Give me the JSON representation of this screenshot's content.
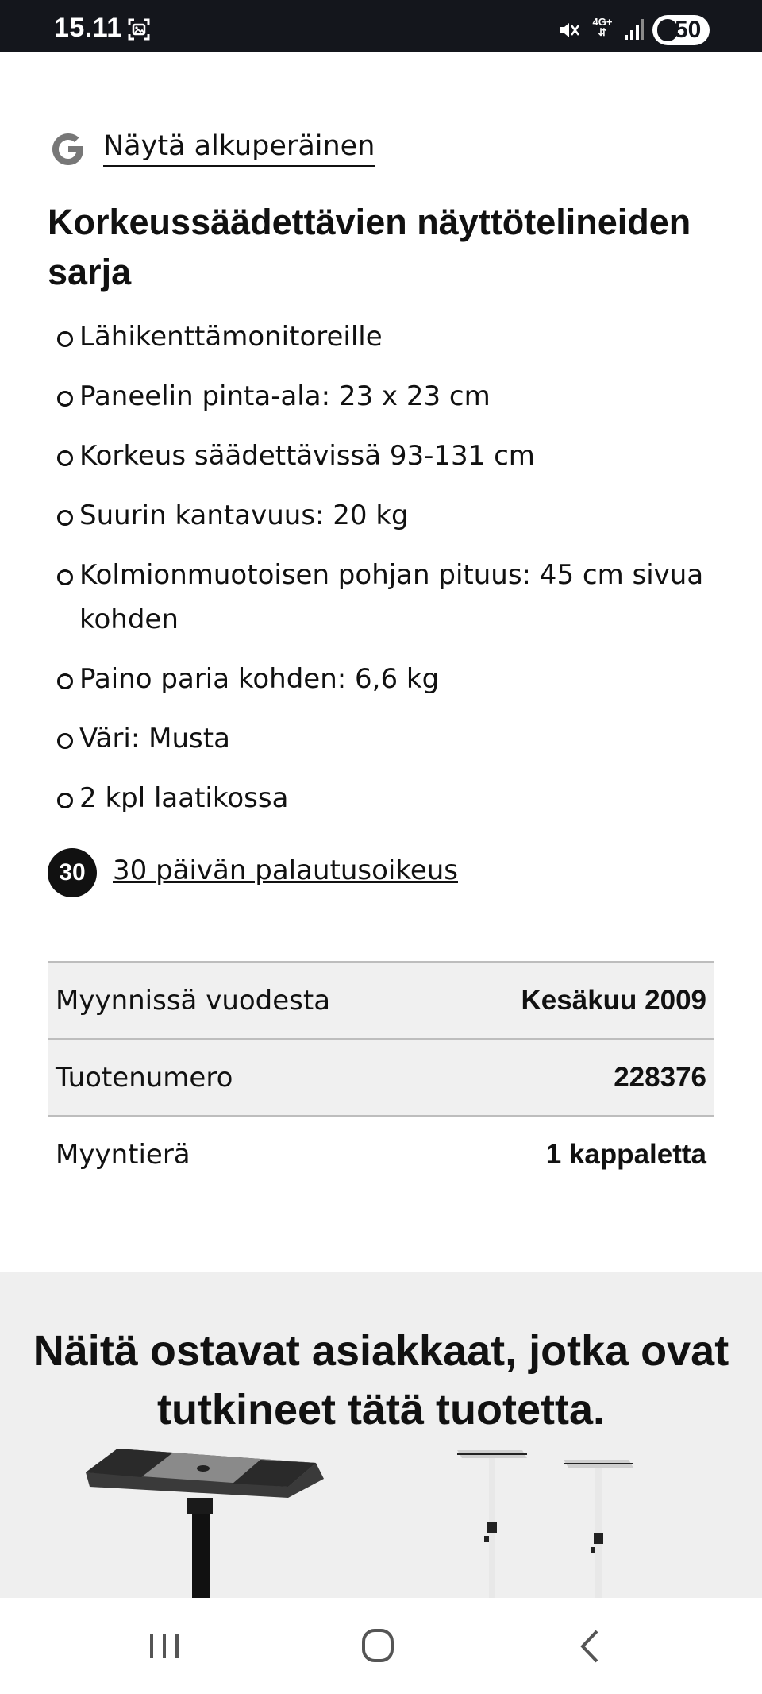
{
  "status_bar": {
    "time": "15.11",
    "network": "4G+",
    "battery": "50",
    "icons": [
      "screenshot-icon",
      "mute-icon",
      "network-icon",
      "signal-icon",
      "battery-icon"
    ]
  },
  "translate": {
    "link_label": "Näytä alkuperäinen",
    "icon": "google-icon"
  },
  "product": {
    "title": "Korkeussäädettävien näyttötelineiden sarja",
    "features": [
      "Lähikenttämonitoreille",
      "Paneelin pinta-ala: 23 x 23 cm",
      "Korkeus säädettävissä 93-131 cm",
      "Suurin kantavuus: 20 kg",
      "Kolmionmuotoisen pohjan pituus: 45 cm sivua kohden",
      "Paino paria kohden: 6,6 kg",
      "Väri: Musta",
      "2 kpl laatikossa"
    ]
  },
  "return_policy": {
    "badge": "30",
    "label": "30 päivän palautusoikeus"
  },
  "details_table": [
    {
      "label": "Myynnissä vuodesta",
      "value": "Kesäkuu 2009"
    },
    {
      "label": "Tuotenumero",
      "value": "228376"
    },
    {
      "label": "Myyntierä",
      "value": "1 kappaletta"
    }
  ],
  "recommendations": {
    "title": "Näitä ostavat asiakkaat, jotka ovat tutkineet tätä tuotetta."
  },
  "nav_bar": {
    "buttons": [
      "recent-apps-icon",
      "home-icon",
      "back-icon"
    ]
  }
}
